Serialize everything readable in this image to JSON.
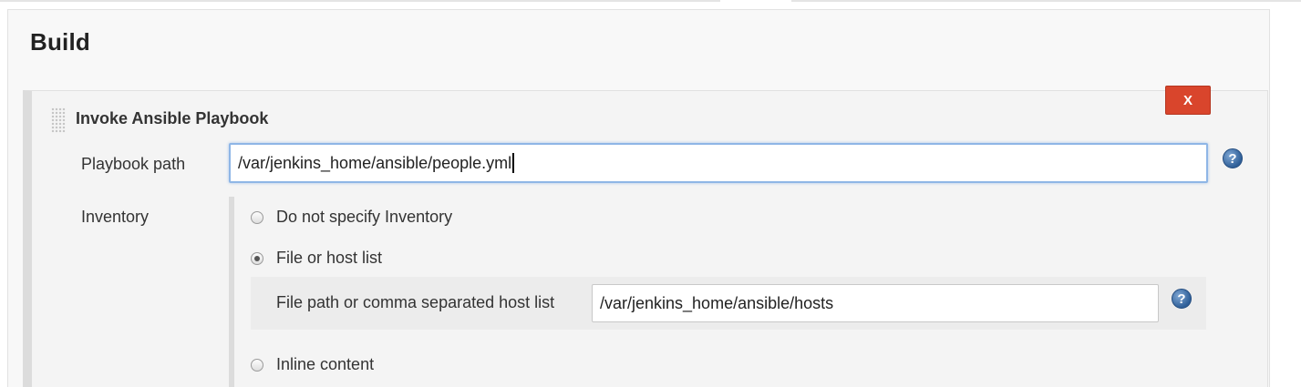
{
  "section": {
    "title": "Build"
  },
  "step": {
    "title": "Invoke Ansible Playbook",
    "delete_label": "X",
    "playbook": {
      "label": "Playbook path",
      "value": "/var/jenkins_home/ansible/people.yml"
    },
    "inventory": {
      "label": "Inventory",
      "options": [
        {
          "label": "Do not specify Inventory",
          "selected": false
        },
        {
          "label": "File or host list",
          "selected": true
        },
        {
          "label": "Inline content",
          "selected": false
        }
      ],
      "file_path": {
        "label": "File path or comma separated host list",
        "value": "/var/jenkins_home/ansible/hosts"
      }
    },
    "help_glyph": "?"
  },
  "icons": {
    "help": "help-icon",
    "drag": "drag-handle-icon"
  },
  "colors": {
    "delete_button": "#d9452c",
    "focus_border": "#8fb6e6",
    "help_icon": "#2f5f98"
  }
}
